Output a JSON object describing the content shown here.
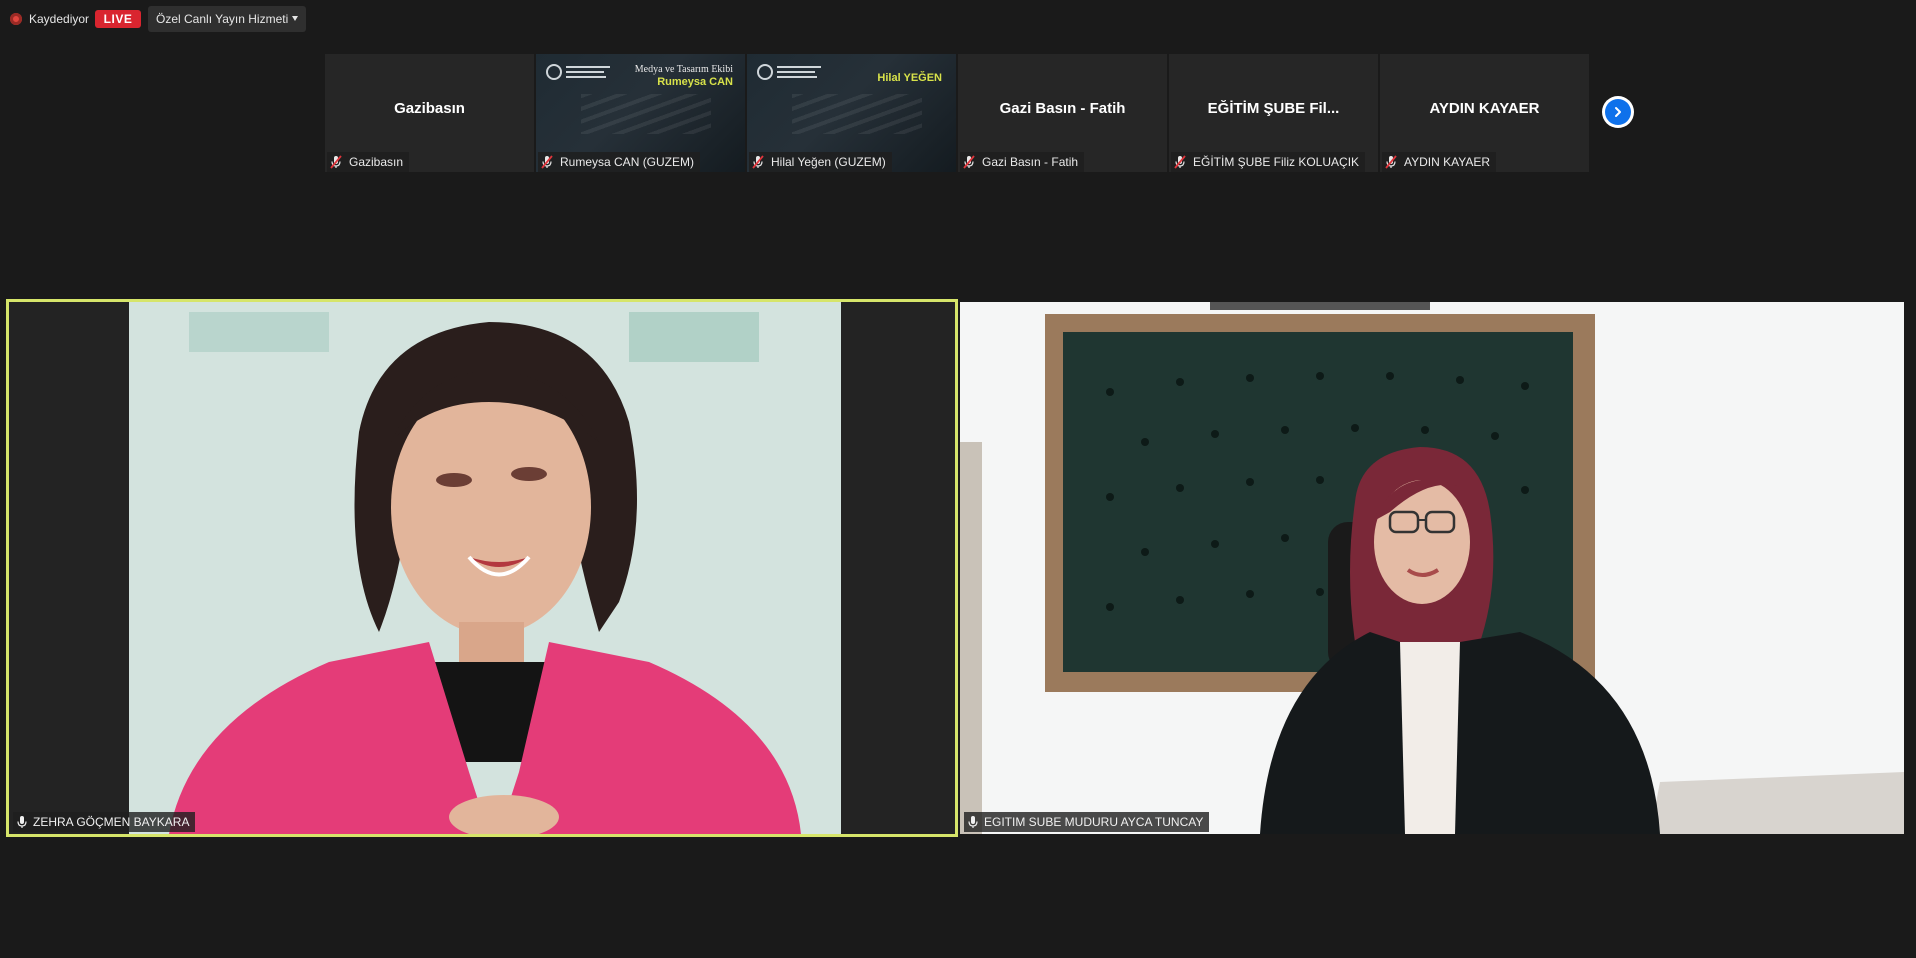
{
  "topbar": {
    "recording_label": "Kaydediyor",
    "live_label": "LIVE",
    "stream_service": "Özel Canlı Yayın Hizmeti"
  },
  "thumbnails": [
    {
      "center_name": "Gazibasın",
      "label": "Gazibasın",
      "type": "name",
      "muted": true
    },
    {
      "center_name": "",
      "label": "Rumeysa CAN (GUZEM)",
      "type": "slide",
      "slide_line1": "Medya ve Tasarım Ekibi",
      "slide_line2": "Rumeysa CAN",
      "muted": true
    },
    {
      "center_name": "",
      "label": "Hilal Yeğen (GUZEM)",
      "type": "slide",
      "slide_line1": "",
      "slide_line2": "Hilal YEĞEN",
      "muted": true
    },
    {
      "center_name": "Gazi Basın - Fatih",
      "label": "Gazi Basın - Fatih",
      "type": "name",
      "muted": true
    },
    {
      "center_name": "EĞİTİM ŞUBE Fil...",
      "label": "EĞİTİM ŞUBE Filiz KOLUAÇIK",
      "type": "name",
      "muted": true
    },
    {
      "center_name": "AYDIN KAYAER",
      "label": "AYDIN KAYAER",
      "type": "name",
      "muted": true
    }
  ],
  "main_videos": [
    {
      "name": "ZEHRA GÖÇMEN BAYKARA",
      "active_speaker": true
    },
    {
      "name": "EGITIM SUBE MUDURU AYCA TUNCAY",
      "active_speaker": false
    }
  ],
  "colors": {
    "background": "#1a1a1a",
    "active_border": "#d6e56a",
    "live_red": "#d9252f",
    "next_blue": "#0e71eb",
    "slide_accent": "#d8e24a"
  }
}
